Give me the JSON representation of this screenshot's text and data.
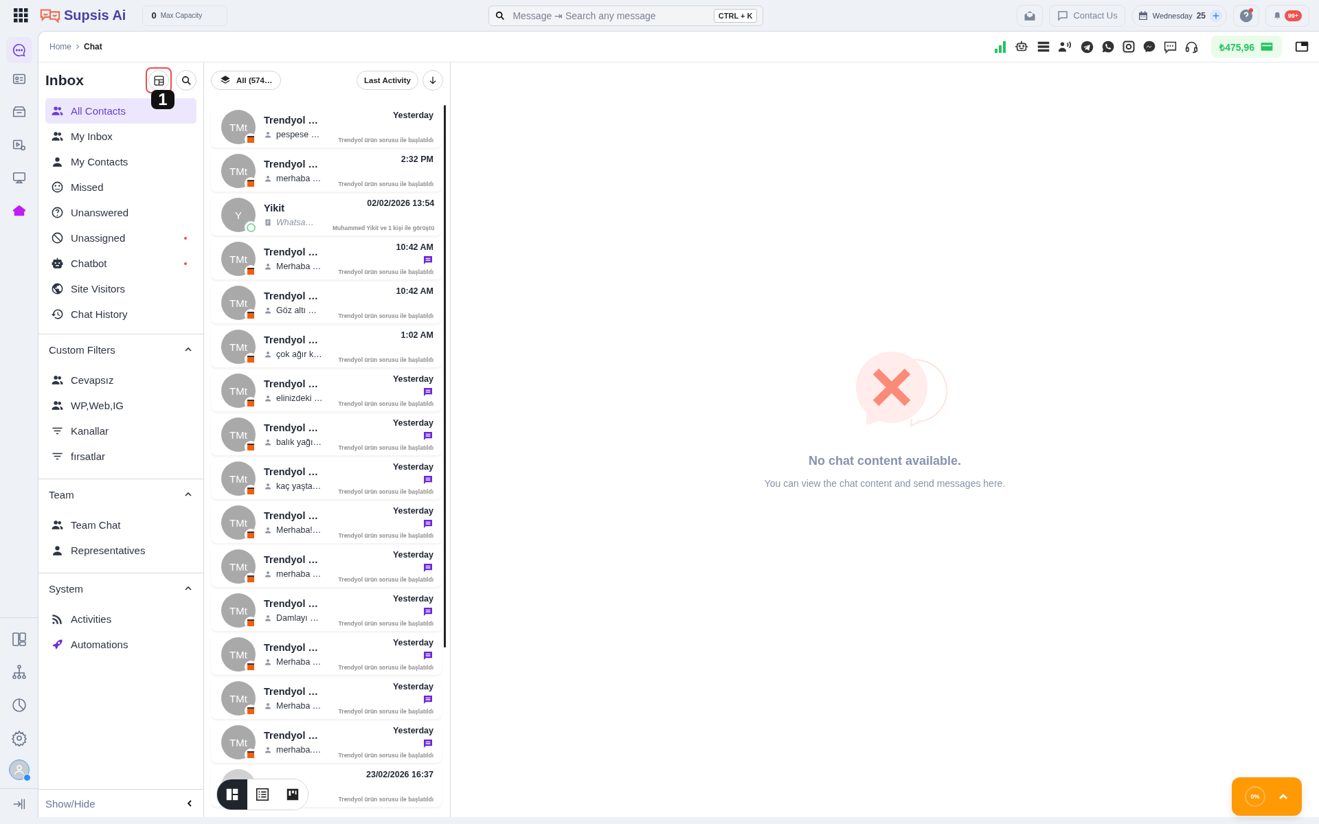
{
  "top_bar": {
    "logo": "Supsis Ai",
    "capacity": {
      "value": "0",
      "label": "Max Capacity"
    },
    "search": {
      "placeholder": "Message ⇥ Search any message",
      "shortcut": "CTRL + K"
    },
    "contact_button": "Contact Us",
    "date": {
      "weekday": "Wednesday",
      "day": "25"
    },
    "help_alert": true,
    "notifications": "99+"
  },
  "rail": [
    {
      "selected": true
    },
    {
      "selected": false
    },
    {
      "selected": false
    },
    {
      "selected": false
    },
    {
      "selected": false
    },
    {
      "selected": false
    }
  ],
  "user": {
    "online": true
  },
  "breadcrumb": [
    "Home",
    "Chat"
  ],
  "balance": "₺475,96",
  "inbox": {
    "title": "Inbox",
    "layout_highlighted": true,
    "tour_step": "1",
    "nav": [
      {
        "label": "All Contacts",
        "selected": true,
        "alert": false
      },
      {
        "label": "My Inbox",
        "selected": false,
        "alert": false
      },
      {
        "label": "My Contacts",
        "selected": false,
        "alert": false
      },
      {
        "label": "Missed",
        "selected": false,
        "alert": false
      },
      {
        "label": "Unanswered",
        "selected": false,
        "alert": false
      },
      {
        "label": "Unassigned",
        "selected": false,
        "alert": true
      },
      {
        "label": "Chatbot",
        "selected": false,
        "alert": true
      },
      {
        "label": "Site Visitors",
        "selected": false,
        "alert": false
      },
      {
        "label": "Chat History",
        "selected": false,
        "alert": false
      }
    ],
    "sections": [
      {
        "title": "Custom Filters",
        "expanded": true,
        "items": [
          "Cevapsız",
          "WP,Web,IG",
          "Kanallar",
          "fırsatlar"
        ]
      },
      {
        "title": "Team",
        "expanded": true,
        "items": [
          "Team Chat",
          "Representatives"
        ]
      },
      {
        "title": "System",
        "expanded": true,
        "items": [
          "Activities",
          "Automations"
        ]
      }
    ],
    "footer": "Show/Hide"
  },
  "list": {
    "filter": "All (574…",
    "sort": "Last Activity",
    "rows": [
      {
        "avatar": {
          "kind": "store",
          "initials": "TMt"
        },
        "name": "Trendyol …",
        "time": "Yesterday",
        "preview": {
          "kind": "person",
          "text": "pespese …"
        },
        "unread": false,
        "subtitle": "Trendyol ürün sorusu ile başlatıldı"
      },
      {
        "avatar": {
          "kind": "store",
          "initials": "TMt"
        },
        "name": "Trendyol …",
        "time": "2:32 PM",
        "preview": {
          "kind": "person",
          "text": "merhaba …"
        },
        "unread": false,
        "subtitle": "Trendyol ürün sorusu ile başlatıldı"
      },
      {
        "avatar": {
          "kind": "whatsapp",
          "initials": "Y"
        },
        "name": "Yikit",
        "time": "02/02/2026 13:54",
        "preview": {
          "kind": "note",
          "text": "Whatsa…"
        },
        "unread": false,
        "subtitle": "Muhammed Yikit ve 1 kişi ile görüştü"
      },
      {
        "avatar": {
          "kind": "store",
          "initials": "TMt"
        },
        "name": "Trendyol …",
        "time": "10:42 AM",
        "preview": {
          "kind": "person",
          "text": "Merhaba …"
        },
        "unread": true,
        "subtitle": "Trendyol ürün sorusu ile başlatıldı"
      },
      {
        "avatar": {
          "kind": "store",
          "initials": "TMt"
        },
        "name": "Trendyol …",
        "time": "10:42 AM",
        "preview": {
          "kind": "person",
          "text": "Göz altı …"
        },
        "unread": false,
        "subtitle": "Trendyol ürün sorusu ile başlatıldı"
      },
      {
        "avatar": {
          "kind": "store",
          "initials": "TMt"
        },
        "name": "Trendyol …",
        "time": "1:02 AM",
        "preview": {
          "kind": "person",
          "text": "çok ağır k…"
        },
        "unread": false,
        "subtitle": "Trendyol ürün sorusu ile başlatıldı"
      },
      {
        "avatar": {
          "kind": "store",
          "initials": "TMt"
        },
        "name": "Trendyol …",
        "time": "Yesterday",
        "preview": {
          "kind": "person",
          "text": "elinizdeki …"
        },
        "unread": true,
        "subtitle": "Trendyol ürün sorusu ile başlatıldı"
      },
      {
        "avatar": {
          "kind": "store",
          "initials": "TMt"
        },
        "name": "Trendyol …",
        "time": "Yesterday",
        "preview": {
          "kind": "person",
          "text": "balık yağı…"
        },
        "unread": true,
        "subtitle": "Trendyol ürün sorusu ile başlatıldı"
      },
      {
        "avatar": {
          "kind": "store",
          "initials": "TMt"
        },
        "name": "Trendyol …",
        "time": "Yesterday",
        "preview": {
          "kind": "person",
          "text": "kaç yaşta…"
        },
        "unread": true,
        "subtitle": "Trendyol ürün sorusu ile başlatıldı"
      },
      {
        "avatar": {
          "kind": "store",
          "initials": "TMt"
        },
        "name": "Trendyol …",
        "time": "Yesterday",
        "preview": {
          "kind": "person",
          "text": "Merhaba!…"
        },
        "unread": true,
        "subtitle": "Trendyol ürün sorusu ile başlatıldı"
      },
      {
        "avatar": {
          "kind": "store",
          "initials": "TMt"
        },
        "name": "Trendyol …",
        "time": "Yesterday",
        "preview": {
          "kind": "person",
          "text": "merhaba …"
        },
        "unread": true,
        "subtitle": "Trendyol ürün sorusu ile başlatıldı"
      },
      {
        "avatar": {
          "kind": "store",
          "initials": "TMt"
        },
        "name": "Trendyol …",
        "time": "Yesterday",
        "preview": {
          "kind": "person",
          "text": "Damlayı …"
        },
        "unread": true,
        "subtitle": "Trendyol ürün sorusu ile başlatıldı"
      },
      {
        "avatar": {
          "kind": "store",
          "initials": "TMt"
        },
        "name": "Trendyol …",
        "time": "Yesterday",
        "preview": {
          "kind": "person",
          "text": "Merhaba …"
        },
        "unread": true,
        "subtitle": "Trendyol ürün sorusu ile başlatıldı"
      },
      {
        "avatar": {
          "kind": "store",
          "initials": "TMt"
        },
        "name": "Trendyol …",
        "time": "Yesterday",
        "preview": {
          "kind": "person",
          "text": "Merhaba …"
        },
        "unread": true,
        "subtitle": "Trendyol ürün sorusu ile başlatıldı"
      },
      {
        "avatar": {
          "kind": "store",
          "initials": "TMt"
        },
        "name": "Trendyol …",
        "time": "Yesterday",
        "preview": {
          "kind": "person",
          "text": "merhaba.…"
        },
        "unread": true,
        "subtitle": "Trendyol ürün sorusu ile başlatıldı"
      },
      {
        "time": "23/02/2026 16:37",
        "unread": false,
        "subtitle": "Trendyol ürün sorusu ile başlatıldı"
      }
    ]
  },
  "view_modes": [
    {
      "selected": true
    },
    {
      "selected": false
    },
    {
      "selected": false
    }
  ],
  "empty_state": {
    "title": "No chat content available.",
    "text": "You can view the chat content and send messages here."
  },
  "progress_button": {
    "label": "0%"
  }
}
